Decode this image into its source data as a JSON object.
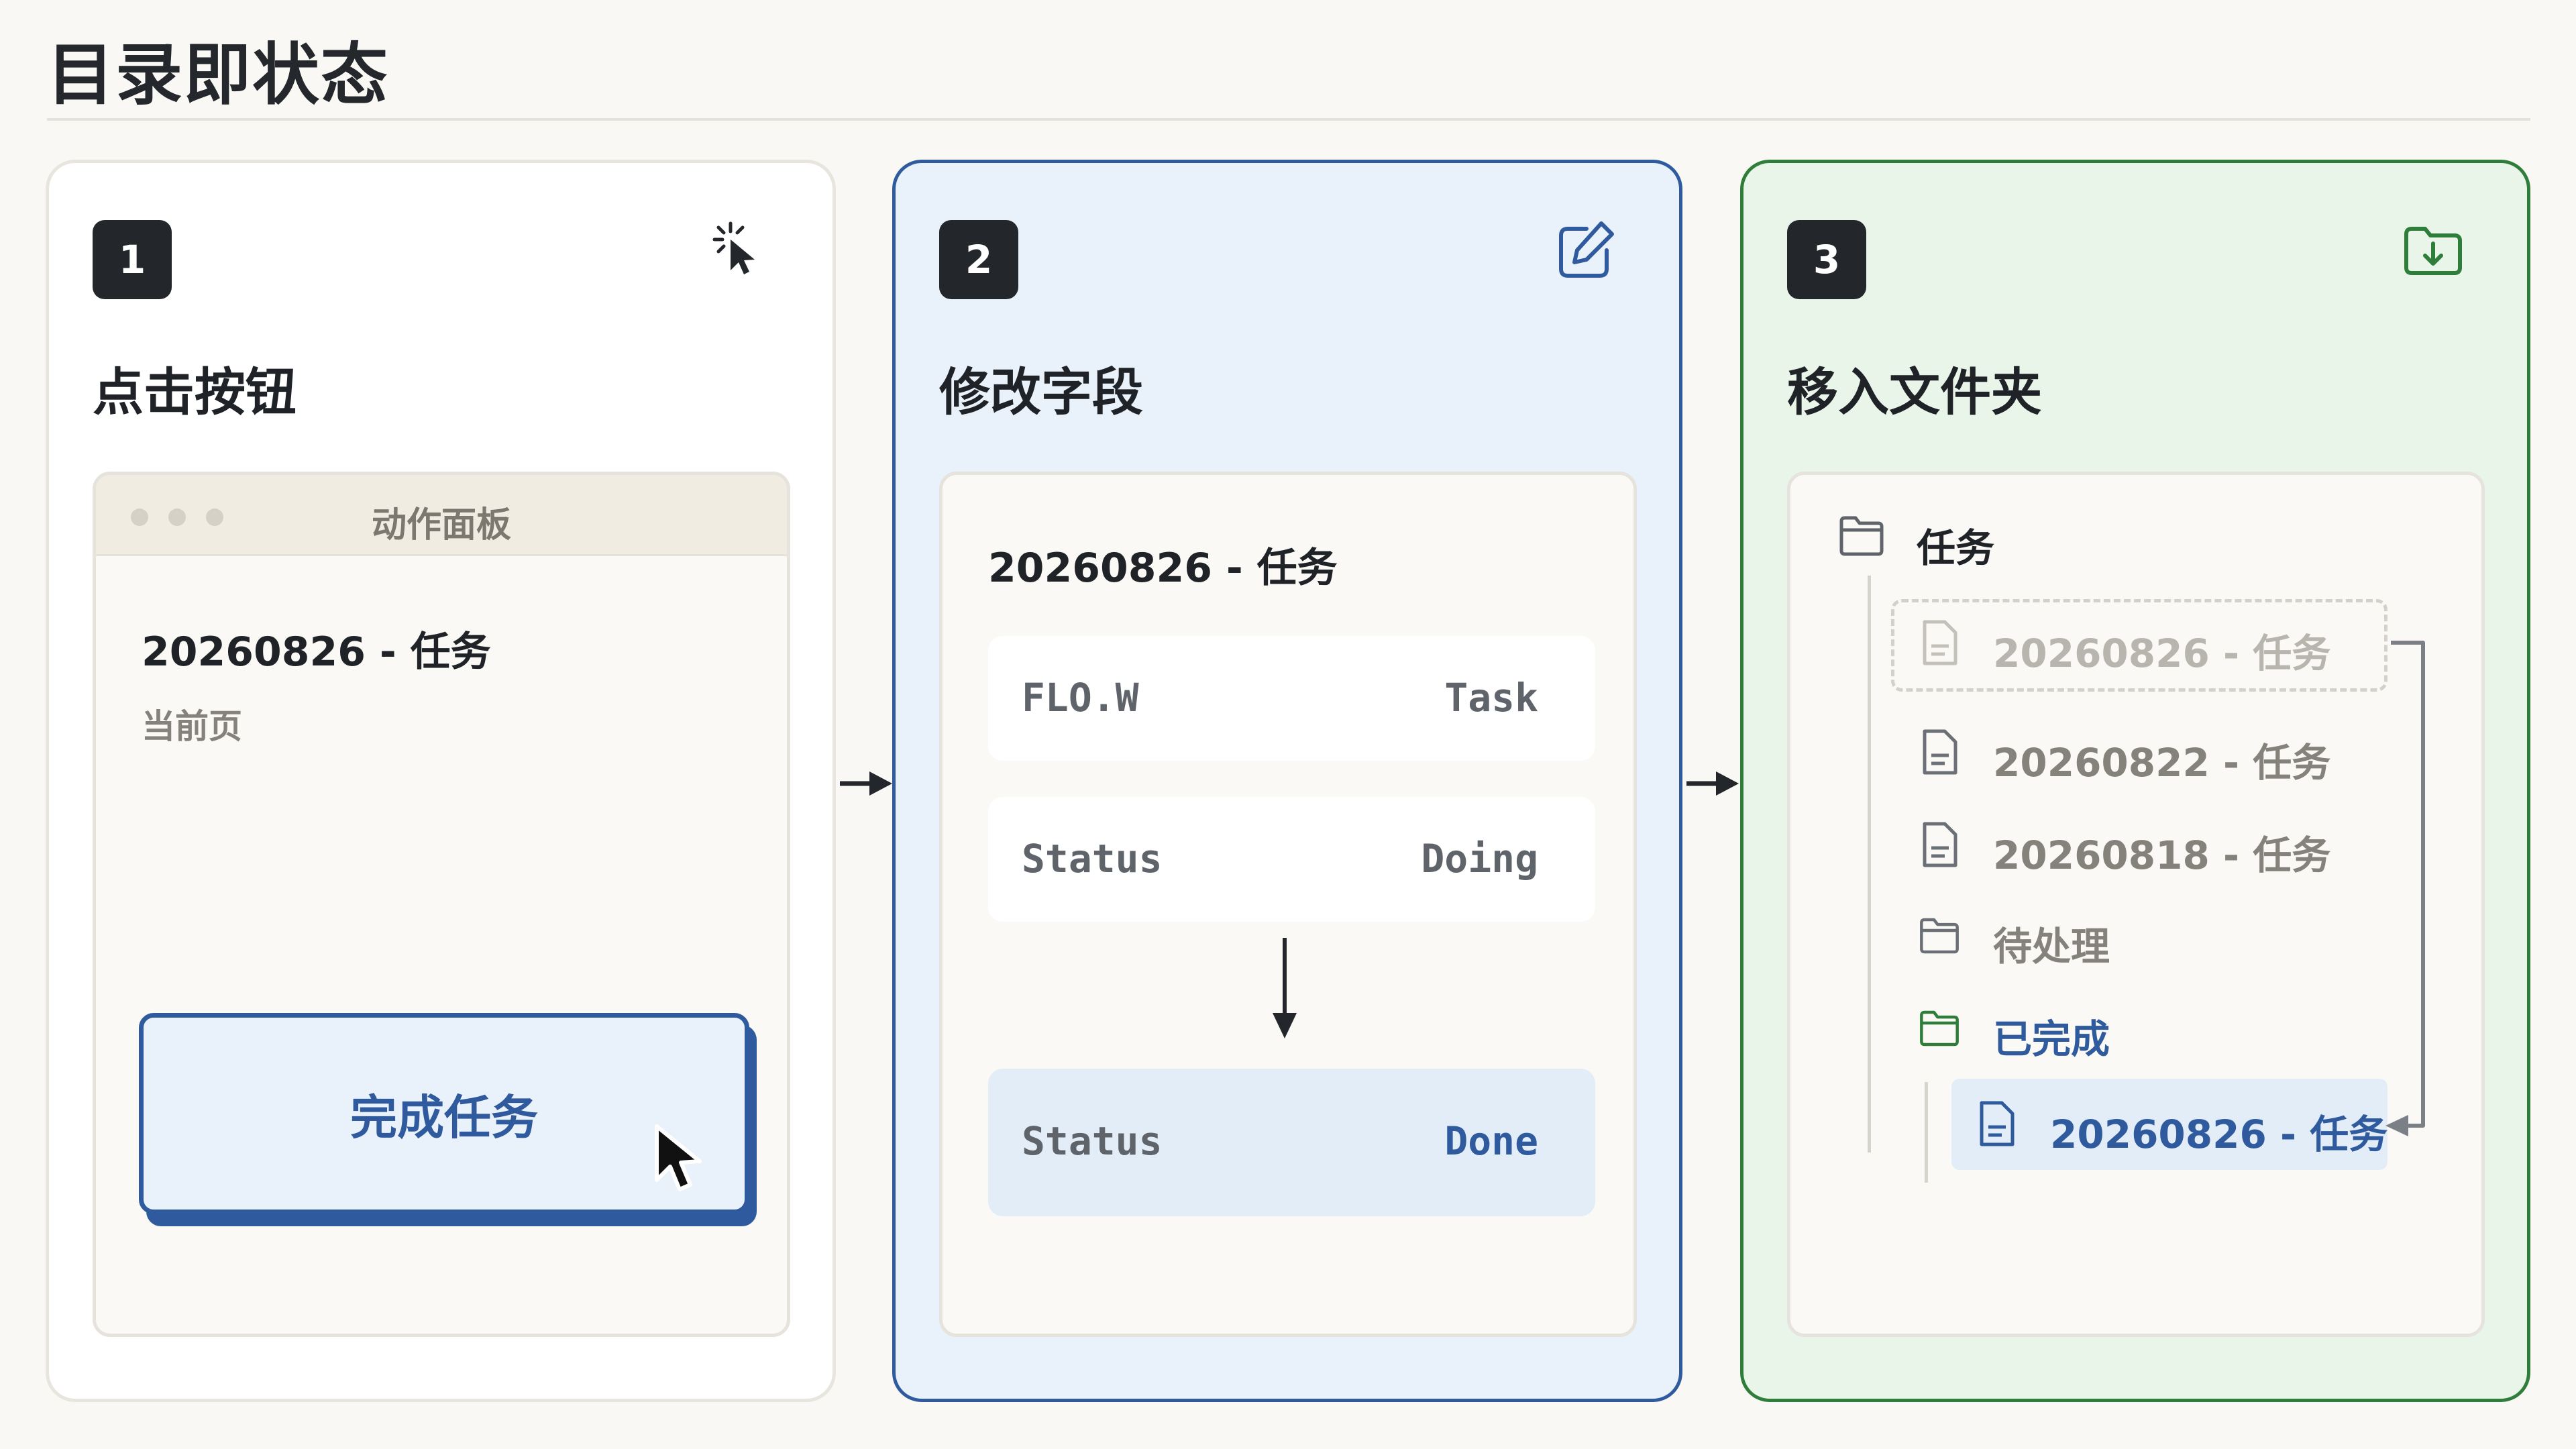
{
  "page": {
    "title": "目录即状态"
  },
  "steps": [
    {
      "number": "1",
      "title": "点击按钮",
      "icon": "click-sparkle-icon"
    },
    {
      "number": "2",
      "title": "修改字段",
      "icon": "edit-icon"
    },
    {
      "number": "3",
      "title": "移入文件夹",
      "icon": "folder-download-icon"
    }
  ],
  "panel": {
    "title": "动作面板",
    "note_title": "20260826 - 任务",
    "note_sub": "当前页",
    "button_label": "完成任务"
  },
  "fields": {
    "note_title": "20260826 - 任务",
    "rows": [
      {
        "key": "FLO.W",
        "value": "Task"
      },
      {
        "key": "Status",
        "value": "Doing"
      }
    ],
    "result": {
      "key": "Status",
      "value": "Done"
    }
  },
  "tree": {
    "root": "任务",
    "items": [
      {
        "label": "20260826 - 任务",
        "icon": "file-icon",
        "state": "moved-out"
      },
      {
        "label": "20260822 - 任务",
        "icon": "file-icon"
      },
      {
        "label": "20260818 - 任务",
        "icon": "file-icon"
      },
      {
        "label": "待处理",
        "icon": "folder-icon"
      },
      {
        "label": "已完成",
        "icon": "folder-icon"
      },
      {
        "label": "20260826 - 任务",
        "icon": "file-icon",
        "state": "moved-in"
      }
    ]
  },
  "colors": {
    "blue": "#2f5b9e",
    "green": "#2f7d3a",
    "dark": "#23272c"
  }
}
